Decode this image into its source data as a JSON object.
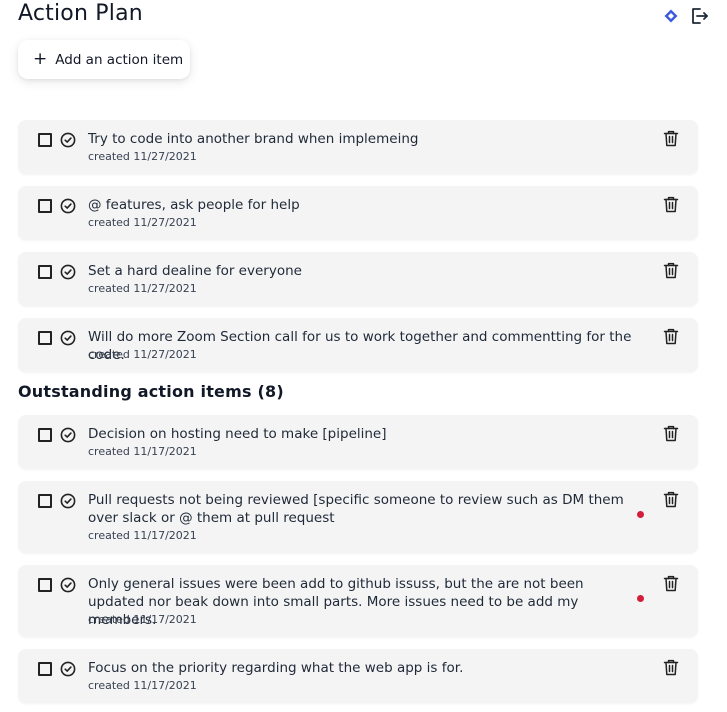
{
  "header": {
    "title": "Action Plan",
    "icons": [
      "diamond-icon",
      "export-icon"
    ],
    "accent": "#3b5bdb"
  },
  "add_button": {
    "icon": "+",
    "label": "Add an action item"
  },
  "current_items": [
    {
      "text": "Try to code into another brand when implemeing",
      "created": "created 11/27/2021"
    },
    {
      "text": "@ features, ask people for help",
      "created": "created 11/27/2021"
    },
    {
      "text": "Set a hard dealine for everyone",
      "created": "created 11/27/2021"
    },
    {
      "text": "Will do more Zoom Section call for us to work together and commentting for the code.",
      "created": "created 11/27/2021"
    }
  ],
  "outstanding": {
    "heading": "Outstanding action items (8)",
    "items": [
      {
        "text": "Decision on hosting need to make [pipeline]",
        "created": "created 11/17/2021"
      },
      {
        "text": "Pull requests not being reviewed [specific someone to review such as DM them over slack or @ them at pull request",
        "created": "created 11/17/2021",
        "flag": true
      },
      {
        "text": "Only general issues were been add to github issuss, but the are not been updated nor beak down into small parts. More issues need to be add my members.",
        "created": "created 11/17/2021",
        "flag": true
      },
      {
        "text": "Focus on the priority regarding what the web app is for.",
        "created": "created 11/17/2021"
      }
    ]
  },
  "colors": {
    "card_bg": "#f4f4f5",
    "flag_dot": "#d41c3b"
  }
}
